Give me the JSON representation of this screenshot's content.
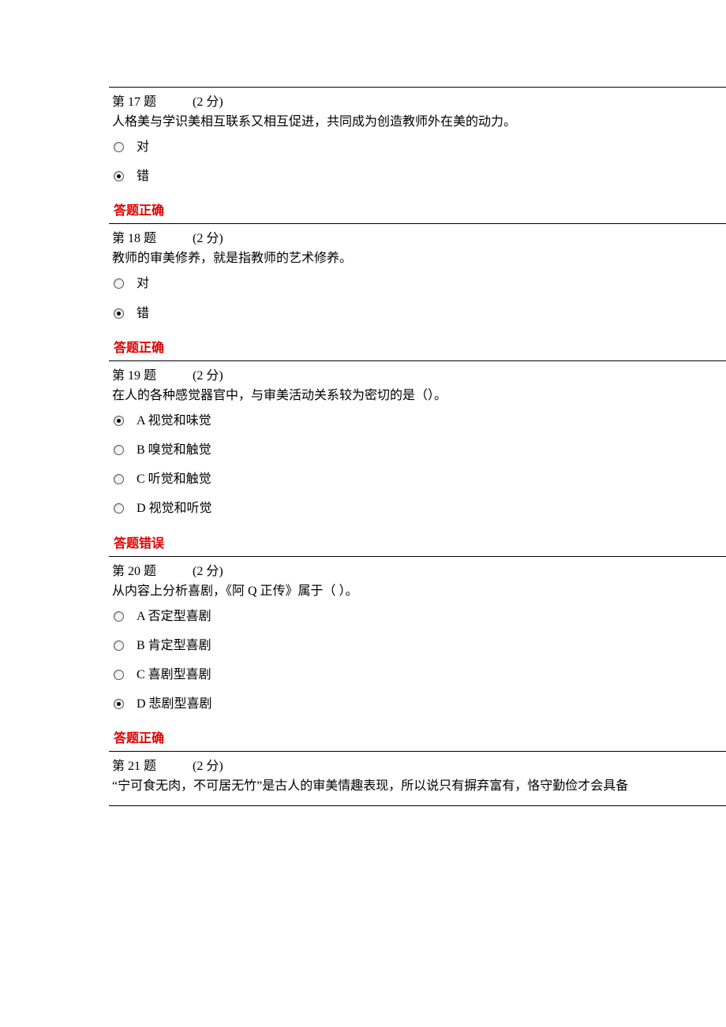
{
  "questions": [
    {
      "number": "第 17 题",
      "points": "(2 分)",
      "text": "人格美与学识美相互联系又相互促进，共同成为创造教师外在美的动力。",
      "options": [
        {
          "label": "对",
          "selected": false
        },
        {
          "label": "错",
          "selected": true
        }
      ],
      "result": {
        "text": "答题正确",
        "correct": true
      }
    },
    {
      "number": "第 18 题",
      "points": "(2 分)",
      "text": "教师的审美修养，就是指教师的艺术修养。",
      "options": [
        {
          "label": "对",
          "selected": false
        },
        {
          "label": "错",
          "selected": true
        }
      ],
      "result": {
        "text": "答题正确",
        "correct": true
      }
    },
    {
      "number": "第 19 题",
      "points": "(2 分)",
      "text": "在人的各种感觉器官中，与审美活动关系较为密切的是（）。",
      "options": [
        {
          "label": "A 视觉和味觉",
          "selected": true
        },
        {
          "label": "B 嗅觉和触觉",
          "selected": false
        },
        {
          "label": "C 听觉和触觉",
          "selected": false
        },
        {
          "label": "D 视觉和听觉",
          "selected": false
        }
      ],
      "result": {
        "text": "答题错误",
        "correct": false
      }
    },
    {
      "number": "第 20 题",
      "points": "(2 分)",
      "text": "从内容上分析喜剧，《阿 Q 正传》属于（ ）。",
      "options": [
        {
          "label": "A 否定型喜剧",
          "selected": false
        },
        {
          "label": "B 肯定型喜剧",
          "selected": false
        },
        {
          "label": "C 喜剧型喜剧",
          "selected": false
        },
        {
          "label": "D 悲剧型喜剧",
          "selected": true
        }
      ],
      "result": {
        "text": "答题正确",
        "correct": true
      }
    },
    {
      "number": "第 21 题",
      "points": "(2 分)",
      "text": "“宁可食无肉，不可居无竹”是古人的审美情趣表现，所以说只有摒弃富有，恪守勤俭才会具备",
      "options": [],
      "result": null
    }
  ]
}
